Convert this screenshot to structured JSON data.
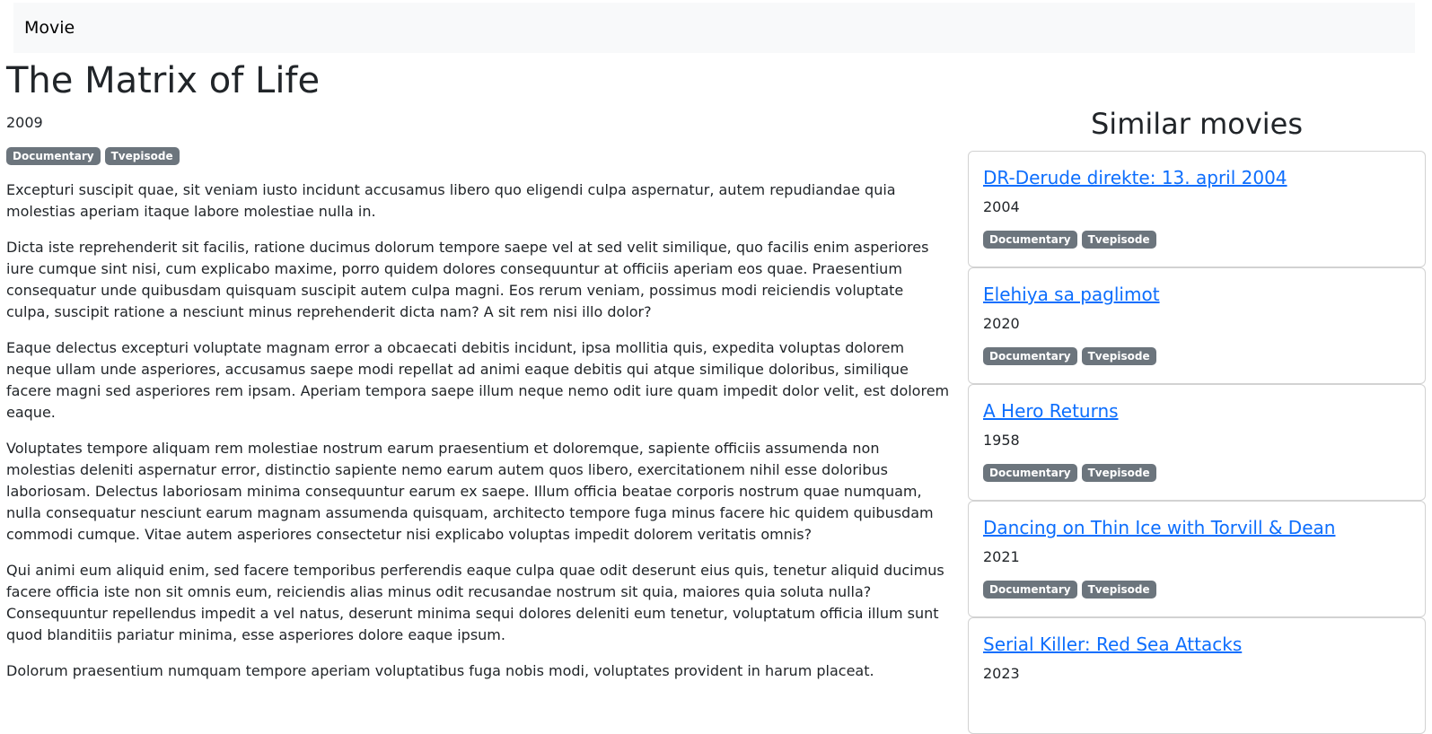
{
  "navbar": {
    "brand": "Movie"
  },
  "movie": {
    "title": "The Matrix of Life",
    "year": "2009",
    "tags": [
      "Documentary",
      "Tvepisode"
    ],
    "paragraphs": [
      "Excepturi suscipit quae, sit veniam iusto incidunt accusamus libero quo eligendi culpa aspernatur, autem repudiandae quia molestias aperiam itaque labore molestiae nulla in.",
      "Dicta iste reprehenderit sit facilis, ratione ducimus dolorum tempore saepe vel at sed velit similique, quo facilis enim asperiores iure cumque sint nisi, cum explicabo maxime, porro quidem dolores consequuntur at officiis aperiam eos quae. Praesentium consequatur unde quibusdam quisquam suscipit autem culpa magni. Eos rerum veniam, possimus modi reiciendis voluptate culpa, suscipit ratione a nesciunt minus reprehenderit dicta nam? A sit rem nisi illo dolor?",
      "Eaque delectus excepturi voluptate magnam error a obcaecati debitis incidunt, ipsa mollitia quis, expedita voluptas dolorem neque ullam unde asperiores, accusamus saepe modi repellat ad animi eaque debitis qui atque similique doloribus, similique facere magni sed asperiores rem ipsam. Aperiam tempora saepe illum neque nemo odit iure quam impedit dolor velit, est dolorem eaque.",
      "Voluptates tempore aliquam rem molestiae nostrum earum praesentium et doloremque, sapiente officiis assumenda non molestias deleniti aspernatur error, distinctio sapiente nemo earum autem quos libero, exercitationem nihil esse doloribus laboriosam. Delectus laboriosam minima consequuntur earum ex saepe. Illum officia beatae corporis nostrum quae numquam, nulla consequatur nesciunt earum magnam assumenda quisquam, architecto tempore fuga minus facere hic quidem quibusdam commodi cumque. Vitae autem asperiores consectetur nisi explicabo voluptas impedit dolorem veritatis omnis?",
      "Qui animi eum aliquid enim, sed facere temporibus perferendis eaque culpa quae odit deserunt eius quis, tenetur aliquid ducimus facere officia iste non sit omnis eum, reiciendis alias minus odit recusandae nostrum sit quia, maiores quia soluta nulla? Consequuntur repellendus impedit a vel natus, deserunt minima sequi dolores deleniti eum tenetur, voluptatum officia illum sunt quod blanditiis pariatur minima, esse asperiores dolore eaque ipsum.",
      "Dolorum praesentium numquam tempore aperiam voluptatibus fuga nobis modi, voluptates provident in harum placeat."
    ]
  },
  "similar": {
    "heading": "Similar movies",
    "items": [
      {
        "title": "DR-Derude direkte: 13. april 2004",
        "year": "2004",
        "tags": [
          "Documentary",
          "Tvepisode"
        ]
      },
      {
        "title": "Elehiya sa paglimot",
        "year": "2020",
        "tags": [
          "Documentary",
          "Tvepisode"
        ]
      },
      {
        "title": "A Hero Returns",
        "year": "1958",
        "tags": [
          "Documentary",
          "Tvepisode"
        ]
      },
      {
        "title": "Dancing on Thin Ice with Torvill & Dean",
        "year": "2021",
        "tags": [
          "Documentary",
          "Tvepisode"
        ]
      },
      {
        "title": "Serial Killer: Red Sea Attacks",
        "year": "2023",
        "tags": []
      }
    ]
  },
  "colors": {
    "navbar_bg": "#f8f9fa",
    "badge_bg": "#6c757d",
    "link": "#0d6efd"
  }
}
